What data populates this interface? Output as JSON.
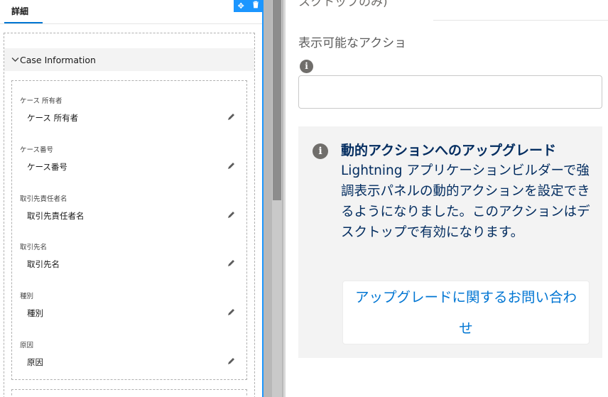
{
  "left": {
    "tab_label": "詳細",
    "toolbar": {
      "move_icon": "✥",
      "delete_icon": "🗑"
    },
    "section_title": "Case Information",
    "fields": [
      {
        "label": "ケース 所有者",
        "value": "ケース 所有者"
      },
      {
        "label": "ケース番号",
        "value": "ケース番号"
      },
      {
        "label": "取引先責任者名",
        "value": "取引先責任者名"
      },
      {
        "label": "取引先名",
        "value": "取引先名"
      },
      {
        "label": "種別",
        "value": "種別"
      },
      {
        "label": "原因",
        "value": "原因"
      }
    ]
  },
  "right": {
    "cut_off_text": "スクトップのみ)",
    "actions_label": "表示可能なアクショ",
    "upgrade": {
      "title": "動的アクションへのアップグレード",
      "body": "Lightning アプリケーションビルダーで強調表示パネルの動的アクションを設定できるようになりました。このアクションはデスクトップで有効になります。",
      "button_label": "アップグレードに関するお問い合わせ"
    }
  },
  "colors": {
    "accent": "#1b96ff",
    "tab_underline": "#0176d3",
    "upgrade_text": "#032d60",
    "link": "#0176d3"
  }
}
